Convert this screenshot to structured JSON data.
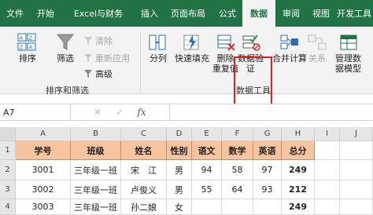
{
  "tabs": [
    {
      "label": "文件"
    },
    {
      "label": "开始"
    },
    {
      "label": "Excel与财务"
    },
    {
      "label": "插入"
    },
    {
      "label": "页面布局"
    },
    {
      "label": "公式"
    },
    {
      "label": "数据"
    },
    {
      "label": "审阅"
    },
    {
      "label": "视图"
    },
    {
      "label": "开发工具"
    }
  ],
  "ribbon": {
    "sort_label": "排序",
    "filter_label": "筛选",
    "clear_label": "清除",
    "reapply_label": "重新应用",
    "advanced_label": "高级",
    "group_sort_filter": "排序和筛选",
    "split_label": "分列",
    "flash_fill_label": "快速填充",
    "remove_dup_line1": "删除",
    "remove_dup_line2": "重复值",
    "validation_line1": "数据验",
    "validation_line2": "证",
    "consolidate_label": "合并计算",
    "relations_label": "关系",
    "data_model_line1": "管理数",
    "data_model_line2": "据模型",
    "group_data_tools": "数据工具"
  },
  "formula_bar": {
    "name_box": "A7",
    "cancel_icon": "✕",
    "enter_icon": "✓",
    "fx_label": "fx",
    "value": ""
  },
  "grid": {
    "columns": [
      "A",
      "B",
      "C",
      "D",
      "E",
      "F",
      "G",
      "H",
      "I",
      "J"
    ],
    "row_numbers": [
      "1",
      "2",
      "3",
      "4"
    ],
    "header": [
      "学号",
      "班级",
      "姓名",
      "性别",
      "语文",
      "数学",
      "英语",
      "总分"
    ],
    "rows": [
      [
        "3001",
        "三年级一班",
        "宋　江",
        "男",
        "94",
        "58",
        "97",
        "249"
      ],
      [
        "3002",
        "三年级一班",
        "卢俊义",
        "男",
        "55",
        "64",
        "93",
        "212"
      ],
      [
        "3003",
        "三年级一班",
        "孙二娘",
        "女",
        "",
        "",
        "",
        "249"
      ]
    ]
  },
  "colors": {
    "accent": "#217346",
    "header_fill": "#f6c59f",
    "highlight": "#e02020"
  }
}
